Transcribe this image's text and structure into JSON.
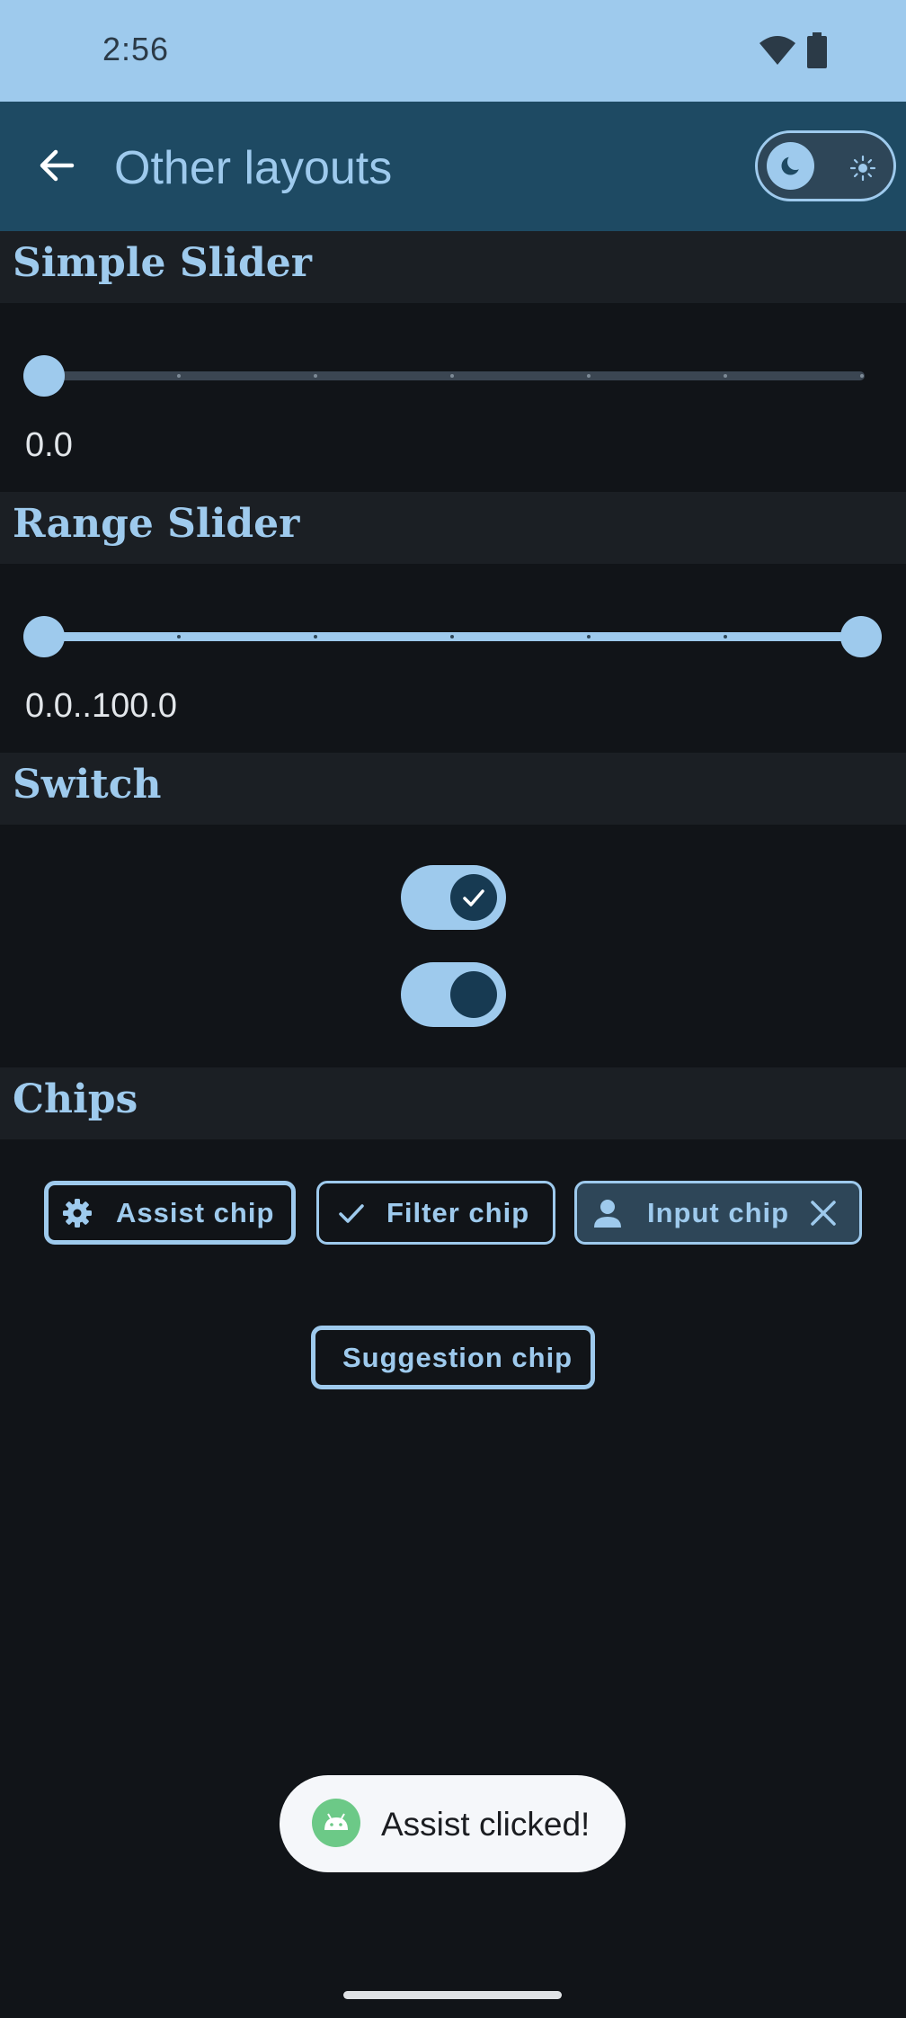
{
  "status_bar": {
    "time": "2:56",
    "icons": [
      "wifi-icon",
      "battery-icon"
    ]
  },
  "app_bar": {
    "title": "Other layouts",
    "back_icon": "arrow-back-icon",
    "theme_toggle": {
      "mode": "dark",
      "icons": [
        "moon-icon",
        "sun-icon"
      ]
    }
  },
  "sections": {
    "simple_slider": {
      "title": "Simple Slider",
      "value": 0.0,
      "value_text": "0.0",
      "min": 0,
      "max": 100,
      "steps": 6
    },
    "range_slider": {
      "title": "Range Slider",
      "start": 0.0,
      "end": 100.0,
      "value_text": "0.0..100.0",
      "min": 0,
      "max": 100,
      "steps": 6
    },
    "switch": {
      "title": "Switch",
      "switches": [
        {
          "checked": true,
          "icon": "check-icon"
        },
        {
          "checked": true,
          "icon": ""
        }
      ]
    },
    "chips": {
      "title": "Chips",
      "assist": {
        "label": "Assist chip",
        "icon": "gear-icon"
      },
      "filter": {
        "label": "Filter chip",
        "icon": "check-icon"
      },
      "input": {
        "label": "Input chip",
        "icon": "person-icon",
        "trailing_icon": "close-icon"
      },
      "suggestion": {
        "label": "Suggestion chip"
      }
    }
  },
  "toast": {
    "text": "Assist clicked!",
    "icon": "android-icon"
  },
  "colors": {
    "primary": "#9ecaed",
    "background": "#111418",
    "app_bar": "#1e4a63",
    "status_bar": "#9ecaed",
    "section_header": "#1b1f24"
  }
}
